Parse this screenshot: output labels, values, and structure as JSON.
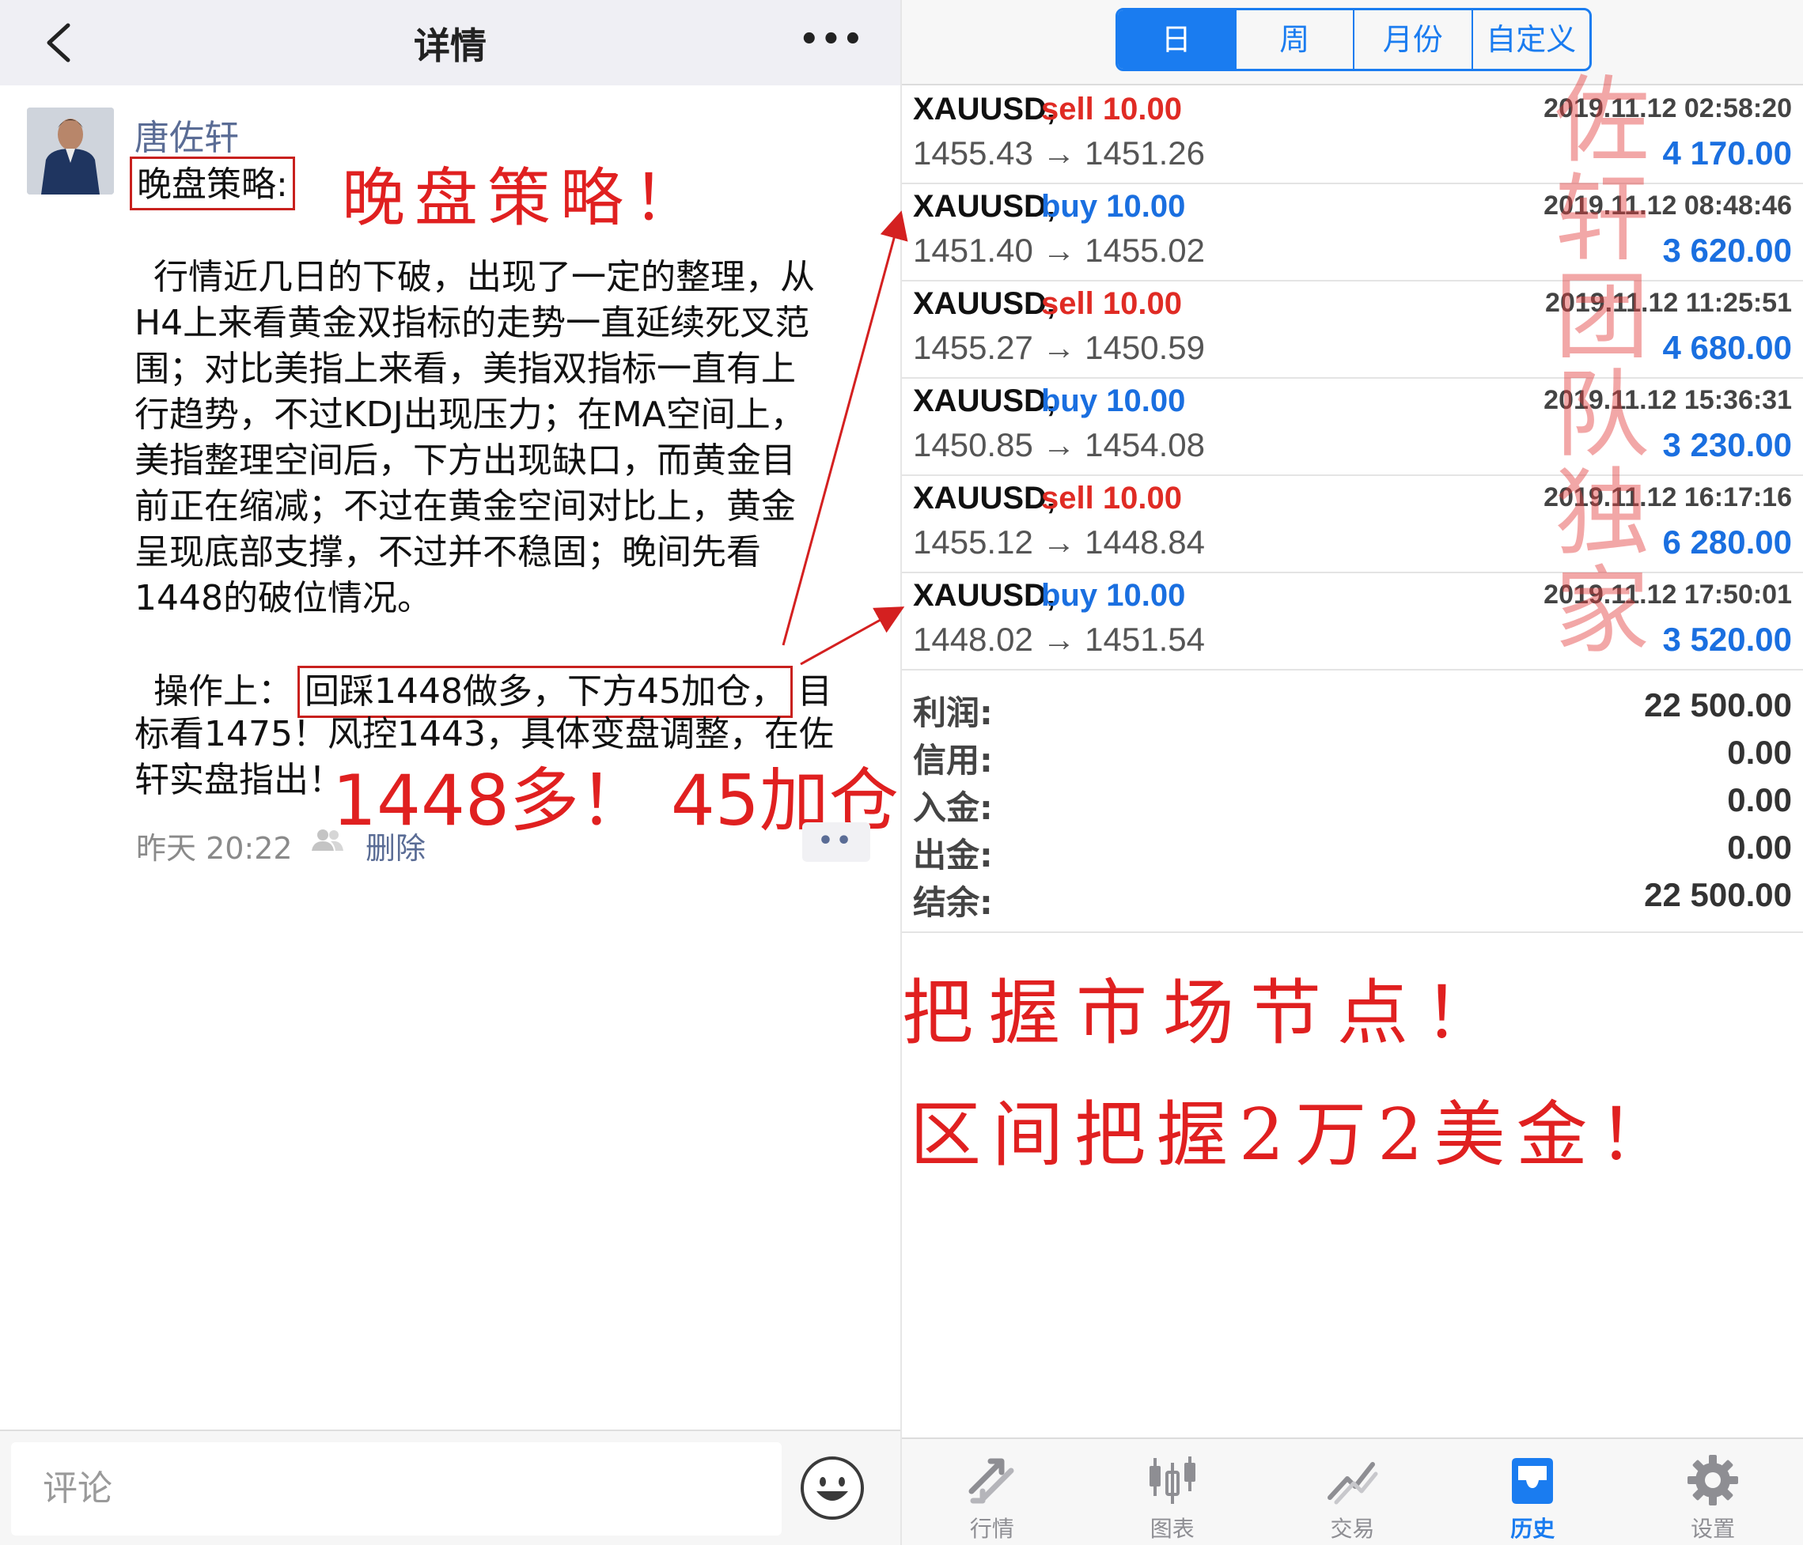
{
  "left": {
    "header": {
      "title": "详情"
    },
    "post": {
      "author": "唐佐轩",
      "title_boxed": "晚盘策略:",
      "handwritten_title": "晚盘策略！",
      "paragraph1": [
        "行情近几日的下破，出现了一定的整理，从",
        "H4上来看黄金双指标的走势一直延续死叉范",
        "围；对比美指上来看，美指双指标一直有上",
        "行趋势，不过KDJ出现压力；在MA空间上，",
        "美指整理空间后，下方出现缺口，而黄金目",
        "前正在缩减；不过在黄金空间对比上，黄金",
        "呈现底部支撑，不过并不稳固；晚间先看",
        "1448的破位情况。"
      ],
      "op_prefix": "操作上：",
      "op_boxed": "回踩1448做多，下方45加仓，",
      "op_suffix": "目",
      "op_line2": "标看1475！风控1443，具体变盘调整，在佐",
      "op_line3": "轩实盘指出！",
      "handwritten_op": "1448多！ 45加仓！",
      "time": "昨天 20:22",
      "delete_label": "删除"
    },
    "comment": {
      "placeholder": "评论"
    }
  },
  "right": {
    "period_tabs": [
      "日",
      "周",
      "月份",
      "自定义"
    ],
    "active_period": "日",
    "trades": [
      {
        "symbol": "XAUUSD,",
        "side": "sell",
        "lots": "10.00",
        "open": "1455.43",
        "close": "1451.26",
        "date": "2019.11.12 02:58:20",
        "profit": "4 170.00"
      },
      {
        "symbol": "XAUUSD,",
        "side": "buy",
        "lots": "10.00",
        "open": "1451.40",
        "close": "1455.02",
        "date": "2019.11.12 08:48:46",
        "profit": "3 620.00"
      },
      {
        "symbol": "XAUUSD,",
        "side": "sell",
        "lots": "10.00",
        "open": "1455.27",
        "close": "1450.59",
        "date": "2019.11.12 11:25:51",
        "profit": "4 680.00"
      },
      {
        "symbol": "XAUUSD,",
        "side": "buy",
        "lots": "10.00",
        "open": "1450.85",
        "close": "1454.08",
        "date": "2019.11.12 15:36:31",
        "profit": "3 230.00"
      },
      {
        "symbol": "XAUUSD,",
        "side": "sell",
        "lots": "10.00",
        "open": "1455.12",
        "close": "1448.84",
        "date": "2019.11.12 16:17:16",
        "profit": "6 280.00"
      },
      {
        "symbol": "XAUUSD,",
        "side": "buy",
        "lots": "10.00",
        "open": "1448.02",
        "close": "1451.54",
        "date": "2019.11.12 17:50:01",
        "profit": "3 520.00"
      }
    ],
    "summary": [
      {
        "label": "利润:",
        "value": "22 500.00"
      },
      {
        "label": "信用:",
        "value": "0.00"
      },
      {
        "label": "入金:",
        "value": "0.00"
      },
      {
        "label": "出金:",
        "value": "0.00"
      },
      {
        "label": "结余:",
        "value": "22 500.00"
      }
    ],
    "watermark": [
      "佐",
      "轩",
      "团",
      "队",
      "独",
      "家"
    ],
    "handwritten_1": "把握市场节点！",
    "handwritten_2": "区间把握2万2美金！",
    "tabs": [
      {
        "label": "行情",
        "icon": "quotes-arrows-icon"
      },
      {
        "label": "图表",
        "icon": "candlestick-chart-icon"
      },
      {
        "label": "交易",
        "icon": "trade-chart-icon"
      },
      {
        "label": "历史",
        "icon": "history-inbox-icon"
      },
      {
        "label": "设置",
        "icon": "settings-gear-icon"
      }
    ],
    "active_tab": "历史"
  },
  "colors": {
    "sell": "#e02b24",
    "buy": "#1a6fe0",
    "accent": "#1a7cf0",
    "annotation_red": "#e02020",
    "link": "#5a6c95"
  }
}
